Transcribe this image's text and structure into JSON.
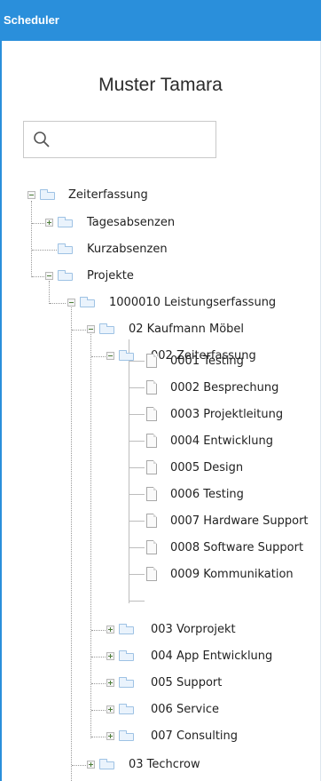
{
  "app": {
    "title": "Scheduler"
  },
  "user": {
    "name": "Muster Tamara"
  },
  "search": {
    "placeholder": "",
    "value": ""
  },
  "tree": {
    "root": {
      "label": "Zeiterfassung",
      "children": {
        "tagesabsenzen": "Tagesabsenzen",
        "kurzabsenzen": "Kurzabsenzen",
        "projekte": "Projekte"
      }
    },
    "leistungserfassung": "1000010 Leistungserfassung",
    "kaufmann": "02 Kaufmann Möbel",
    "zeiterfassung_002": "002 Zeiterfassung",
    "tasks": [
      "0001 Testing",
      "0002 Besprechung",
      "0003 Projektleitung",
      "0004 Entwicklung",
      "0005 Design",
      "0006 Testing",
      "0007 Hardware Support",
      "0008 Software Support",
      "0009 Kommunikation"
    ],
    "subprojects": [
      "003 Vorprojekt",
      "004 App Entwicklung",
      "005 Support",
      "006 Service",
      "007 Consulting"
    ],
    "techcrow": "03 Techcrow"
  }
}
